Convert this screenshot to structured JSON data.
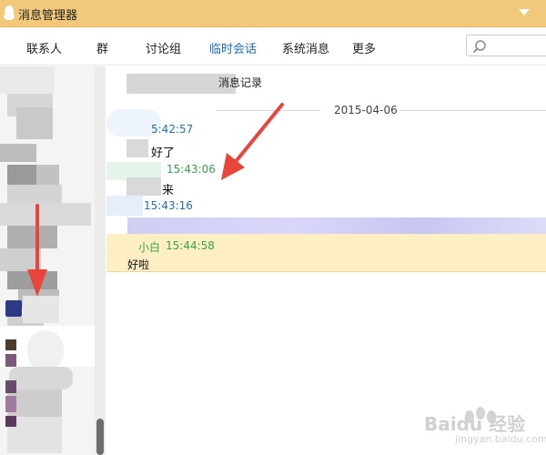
{
  "window": {
    "title": "消息管理器"
  },
  "tabs": [
    {
      "label": "联系人"
    },
    {
      "label": "群"
    },
    {
      "label": "讨论组"
    },
    {
      "label": "临时会话",
      "active": true
    },
    {
      "label": "系统消息"
    },
    {
      "label": "更多"
    }
  ],
  "search": {
    "placeholder": ""
  },
  "history": {
    "title": "消息记录",
    "date": "2015-04-06",
    "messages": [
      {
        "time": "5:42:57",
        "text": "好了"
      },
      {
        "time": "15:43:06",
        "text": "来"
      },
      {
        "time": "15:43:16",
        "text": ""
      },
      {
        "sender": "小白",
        "time": "15:44:58",
        "text": "好啦"
      }
    ]
  },
  "watermark": {
    "text": "Baidu 经验",
    "sub": "jingyan.baidu.com"
  },
  "colors": {
    "titlebar": "#f2c97a",
    "active_tab": "#1c6fc1",
    "time_blue": "#1c6fc1",
    "time_green": "#35a24a",
    "highlight": "#fdeec4",
    "arrow": "#e8453c"
  }
}
